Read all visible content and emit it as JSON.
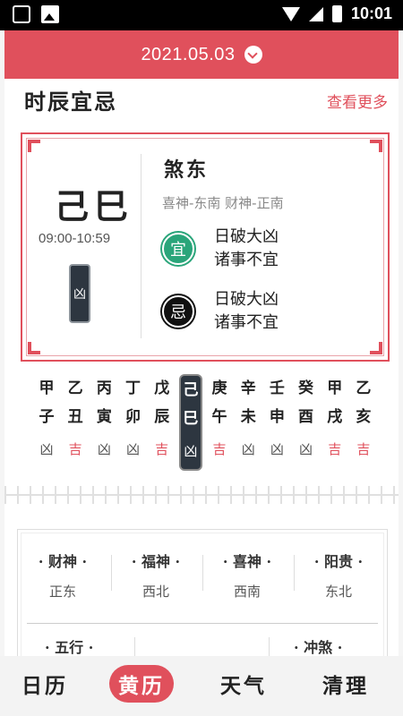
{
  "status_bar": {
    "time": "10:01"
  },
  "header": {
    "date": "2021.05.03"
  },
  "section": {
    "title": "时辰宜忌",
    "more": "查看更多"
  },
  "card": {
    "hour_name": "己巳",
    "hour_range": "09:00-10:59",
    "hour_tag": "凶",
    "sha": "煞东",
    "gods": "喜神-东南  财神-正南",
    "yi_badge": "宜",
    "yi_text": "日破大凶\n诸事不宜",
    "ji_badge": "忌",
    "ji_text": "日破大凶\n诸事不宜"
  },
  "hours": [
    {
      "stem": "甲",
      "branch": "子",
      "luck": "凶"
    },
    {
      "stem": "乙",
      "branch": "丑",
      "luck": "吉"
    },
    {
      "stem": "丙",
      "branch": "寅",
      "luck": "凶"
    },
    {
      "stem": "丁",
      "branch": "卯",
      "luck": "凶"
    },
    {
      "stem": "戊",
      "branch": "辰",
      "luck": "吉"
    },
    {
      "stem": "己",
      "branch": "巳",
      "luck": "凶"
    },
    {
      "stem": "庚",
      "branch": "午",
      "luck": "吉"
    },
    {
      "stem": "辛",
      "branch": "未",
      "luck": "凶"
    },
    {
      "stem": "壬",
      "branch": "申",
      "luck": "凶"
    },
    {
      "stem": "癸",
      "branch": "酉",
      "luck": "凶"
    },
    {
      "stem": "甲",
      "branch": "戌",
      "luck": "吉"
    },
    {
      "stem": "乙",
      "branch": "亥",
      "luck": "吉"
    }
  ],
  "gods_card": {
    "items": [
      {
        "title": "· 财神 ·",
        "value": "正东"
      },
      {
        "title": "· 福神 ·",
        "value": "西北"
      },
      {
        "title": "· 喜神 ·",
        "value": "西南"
      },
      {
        "title": "· 阳贵 ·",
        "value": "东北"
      }
    ],
    "bottom_left": "· 五行 ·",
    "bottom_right": "· 冲煞 ·"
  },
  "nav": {
    "items": [
      "日历",
      "黄历",
      "天气",
      "清理"
    ]
  }
}
